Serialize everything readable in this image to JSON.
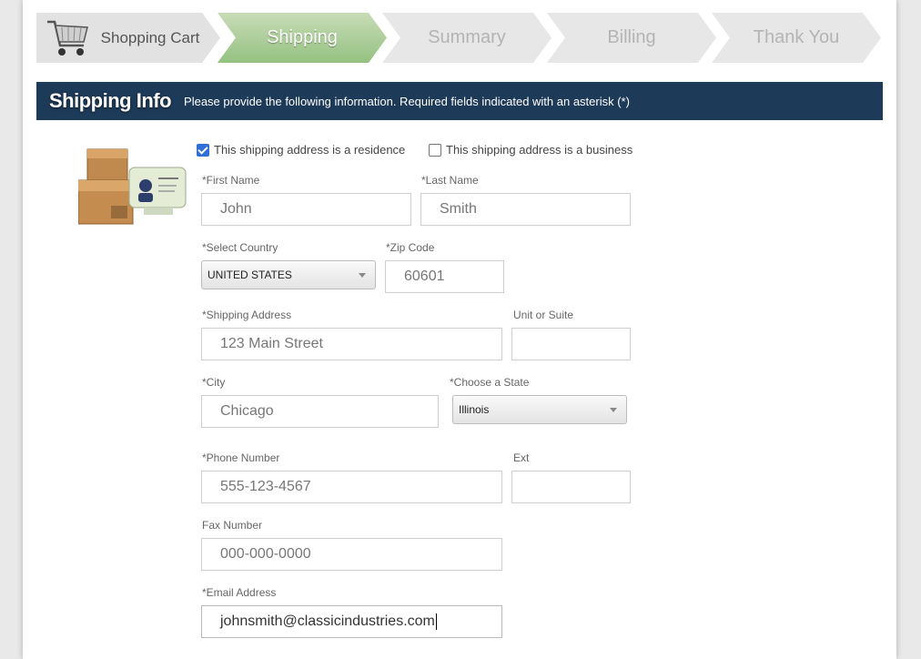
{
  "steps": [
    {
      "label": "Shopping Cart"
    },
    {
      "label": "Shipping"
    },
    {
      "label": "Summary"
    },
    {
      "label": "Billing"
    },
    {
      "label": "Thank You"
    }
  ],
  "info_bar": {
    "title": "Shipping Info",
    "description": "Please provide the following information. Required fields indicated with an asterisk (*)"
  },
  "address_type": {
    "residence_label": "This shipping address is a residence",
    "residence_checked": true,
    "business_label": "This shipping address is a business",
    "business_checked": false
  },
  "form": {
    "first_name": {
      "label": "*First Name",
      "value": "John"
    },
    "last_name": {
      "label": "*Last Name",
      "value": "Smith"
    },
    "country": {
      "label": "*Select Country",
      "value": "UNITED STATES"
    },
    "zip": {
      "label": "*Zip Code",
      "value": "60601"
    },
    "address": {
      "label": "*Shipping Address",
      "value": "123 Main Street"
    },
    "unit": {
      "label": "Unit or Suite",
      "value": ""
    },
    "city": {
      "label": "*City",
      "value": "Chicago"
    },
    "state": {
      "label": "*Choose a State",
      "value": "Illinois"
    },
    "phone": {
      "label": "*Phone Number",
      "value": "555-123-4567"
    },
    "ext": {
      "label": "Ext",
      "value": ""
    },
    "fax": {
      "label": "Fax Number",
      "value": "000-000-0000"
    },
    "email": {
      "label": "*Email Address",
      "value": "johnsmith@classicindustries.com"
    }
  },
  "colors": {
    "header_bar": "#1d3a58",
    "active_step": "#94c180",
    "inactive_step": "#e7e7e7"
  }
}
